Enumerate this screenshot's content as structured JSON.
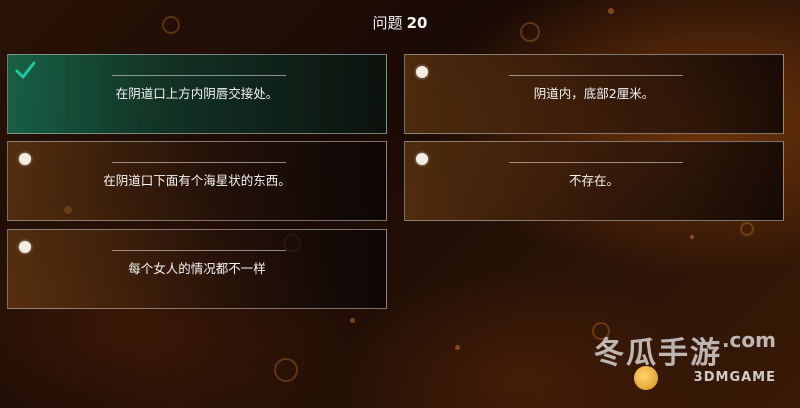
{
  "header": {
    "question_label": "问题",
    "question_number": "20"
  },
  "options": [
    {
      "text": "在阴道口上方内阴唇交接处。",
      "selected": true
    },
    {
      "text": "阴道内，底部2厘米。",
      "selected": false
    },
    {
      "text": "在阴道口下面有个海星状的东西。",
      "selected": false
    },
    {
      "text": "不存在。",
      "selected": false
    },
    {
      "text": "每个女人的情况都不一样",
      "selected": false
    }
  ],
  "watermark": {
    "main": "冬瓜手游",
    "domain": ".com",
    "sub": "3DMGAME"
  },
  "colors": {
    "selected_accent": "#1fc9a0",
    "radio_fill": "#f3ece4"
  }
}
